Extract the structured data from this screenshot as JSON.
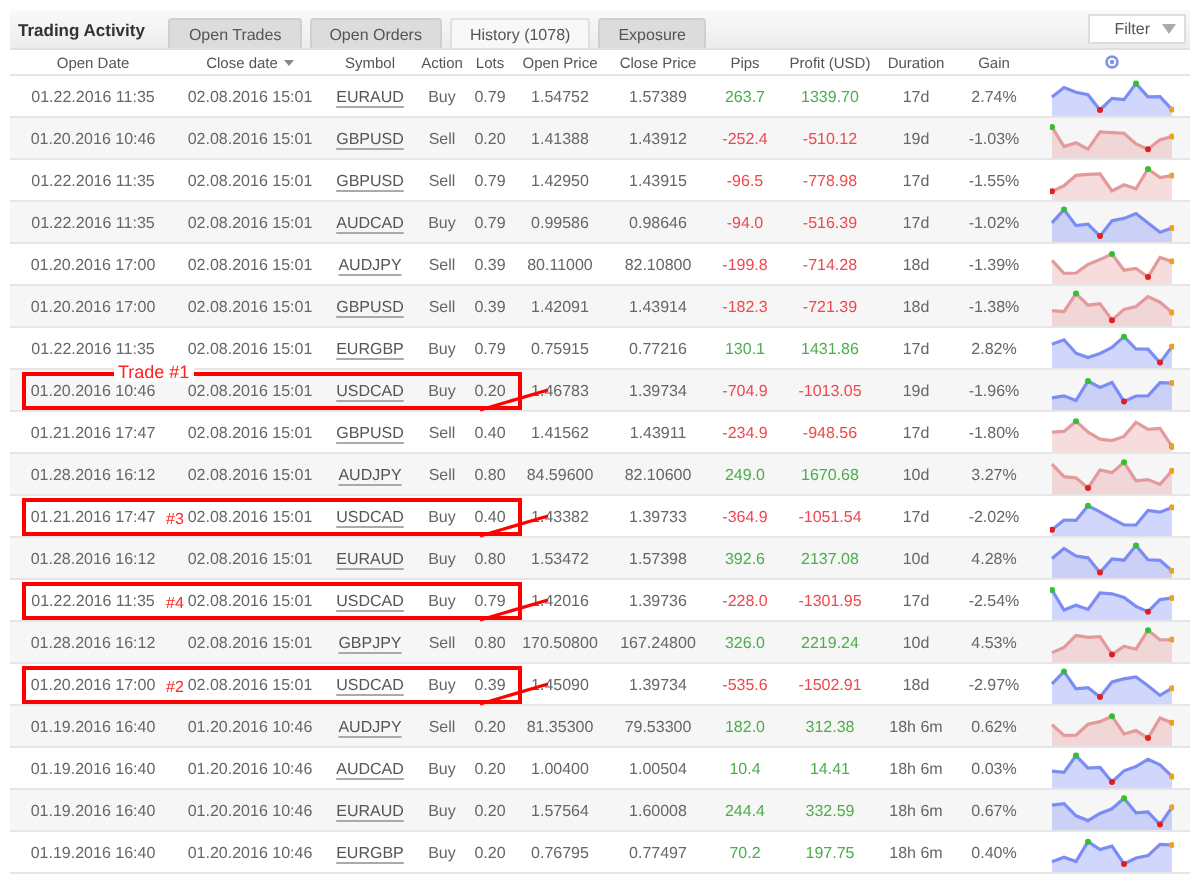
{
  "title": "Trading Activity",
  "tabs": [
    {
      "label": "Open Trades",
      "selected": false
    },
    {
      "label": "Open Orders",
      "selected": false
    },
    {
      "label": "History (1078)",
      "selected": true
    },
    {
      "label": "Exposure",
      "selected": false
    }
  ],
  "filter_button": "Filter",
  "columns": [
    "Open Date",
    "Close date",
    "Symbol",
    "Action",
    "Lots",
    "Open Price",
    "Close Price",
    "Pips",
    "Profit (USD)",
    "Duration",
    "Gain"
  ],
  "rows": [
    {
      "open_date": "01.22.2016 11:35",
      "close_date": "02.08.2016 15:01",
      "symbol": "EURAUD",
      "action": "Buy",
      "lots": "0.79",
      "open_price": "1.54752",
      "close_price": "1.57389",
      "pips": "263.7",
      "profit": "1339.70",
      "duration": "17d",
      "gain": "2.74%",
      "loss": false,
      "color": "#7b8cf5"
    },
    {
      "open_date": "01.20.2016 10:46",
      "close_date": "02.08.2016 15:01",
      "symbol": "GBPUSD",
      "action": "Sell",
      "lots": "0.20",
      "open_price": "1.41388",
      "close_price": "1.43912",
      "pips": "-252.4",
      "profit": "-510.12",
      "duration": "19d",
      "gain": "-1.03%",
      "loss": true,
      "color": "#e49a9a"
    },
    {
      "open_date": "01.22.2016 11:35",
      "close_date": "02.08.2016 15:01",
      "symbol": "GBPUSD",
      "action": "Sell",
      "lots": "0.79",
      "open_price": "1.42950",
      "close_price": "1.43915",
      "pips": "-96.5",
      "profit": "-778.98",
      "duration": "17d",
      "gain": "-1.55%",
      "loss": true,
      "color": "#e49a9a"
    },
    {
      "open_date": "01.22.2016 11:35",
      "close_date": "02.08.2016 15:01",
      "symbol": "AUDCAD",
      "action": "Buy",
      "lots": "0.79",
      "open_price": "0.99586",
      "close_price": "0.98646",
      "pips": "-94.0",
      "profit": "-516.39",
      "duration": "17d",
      "gain": "-1.02%",
      "loss": true,
      "color": "#7b8cf5"
    },
    {
      "open_date": "01.20.2016 17:00",
      "close_date": "02.08.2016 15:01",
      "symbol": "AUDJPY",
      "action": "Sell",
      "lots": "0.39",
      "open_price": "80.11000",
      "close_price": "82.10800",
      "pips": "-199.8",
      "profit": "-714.28",
      "duration": "18d",
      "gain": "-1.39%",
      "loss": true,
      "color": "#e49a9a"
    },
    {
      "open_date": "01.20.2016 17:00",
      "close_date": "02.08.2016 15:01",
      "symbol": "GBPUSD",
      "action": "Sell",
      "lots": "0.39",
      "open_price": "1.42091",
      "close_price": "1.43914",
      "pips": "-182.3",
      "profit": "-721.39",
      "duration": "18d",
      "gain": "-1.38%",
      "loss": true,
      "color": "#e49a9a"
    },
    {
      "open_date": "01.22.2016 11:35",
      "close_date": "02.08.2016 15:01",
      "symbol": "EURGBP",
      "action": "Buy",
      "lots": "0.79",
      "open_price": "0.75915",
      "close_price": "0.77216",
      "pips": "130.1",
      "profit": "1431.86",
      "duration": "17d",
      "gain": "2.82%",
      "loss": false,
      "color": "#7b8cf5"
    },
    {
      "open_date": "01.20.2016 10:46",
      "close_date": "02.08.2016 15:01",
      "symbol": "USDCAD",
      "action": "Buy",
      "lots": "0.20",
      "open_price": "1.46783",
      "close_price": "1.39734",
      "pips": "-704.9",
      "profit": "-1013.05",
      "duration": "19d",
      "gain": "-1.96%",
      "loss": true,
      "color": "#7b8cf5",
      "annotation": {
        "label": "Trade #1",
        "label_above": true
      }
    },
    {
      "open_date": "01.21.2016 17:47",
      "close_date": "02.08.2016 15:01",
      "symbol": "GBPUSD",
      "action": "Sell",
      "lots": "0.40",
      "open_price": "1.41562",
      "close_price": "1.43911",
      "pips": "-234.9",
      "profit": "-948.56",
      "duration": "17d",
      "gain": "-1.80%",
      "loss": true,
      "color": "#e49a9a"
    },
    {
      "open_date": "01.28.2016 16:12",
      "close_date": "02.08.2016 15:01",
      "symbol": "AUDJPY",
      "action": "Sell",
      "lots": "0.80",
      "open_price": "84.59600",
      "close_price": "82.10600",
      "pips": "249.0",
      "profit": "1670.68",
      "duration": "10d",
      "gain": "3.27%",
      "loss": false,
      "color": "#e49a9a"
    },
    {
      "open_date": "01.21.2016 17:47",
      "close_date": "02.08.2016 15:01",
      "symbol": "USDCAD",
      "action": "Buy",
      "lots": "0.40",
      "open_price": "1.43382",
      "close_price": "1.39733",
      "pips": "-364.9",
      "profit": "-1051.54",
      "duration": "17d",
      "gain": "-2.02%",
      "loss": true,
      "color": "#7b8cf5",
      "annotation": {
        "label": "#3",
        "label_above": false
      }
    },
    {
      "open_date": "01.28.2016 16:12",
      "close_date": "02.08.2016 15:01",
      "symbol": "EURAUD",
      "action": "Buy",
      "lots": "0.80",
      "open_price": "1.53472",
      "close_price": "1.57398",
      "pips": "392.6",
      "profit": "2137.08",
      "duration": "10d",
      "gain": "4.28%",
      "loss": false,
      "color": "#7b8cf5"
    },
    {
      "open_date": "01.22.2016 11:35",
      "close_date": "02.08.2016 15:01",
      "symbol": "USDCAD",
      "action": "Buy",
      "lots": "0.79",
      "open_price": "1.42016",
      "close_price": "1.39736",
      "pips": "-228.0",
      "profit": "-1301.95",
      "duration": "17d",
      "gain": "-2.54%",
      "loss": true,
      "color": "#7b8cf5",
      "annotation": {
        "label": "#4",
        "label_above": false
      }
    },
    {
      "open_date": "01.28.2016 16:12",
      "close_date": "02.08.2016 15:01",
      "symbol": "GBPJPY",
      "action": "Sell",
      "lots": "0.80",
      "open_price": "170.50800",
      "close_price": "167.24800",
      "pips": "326.0",
      "profit": "2219.24",
      "duration": "10d",
      "gain": "4.53%",
      "loss": false,
      "color": "#e49a9a"
    },
    {
      "open_date": "01.20.2016 17:00",
      "close_date": "02.08.2016 15:01",
      "symbol": "USDCAD",
      "action": "Buy",
      "lots": "0.39",
      "open_price": "1.45090",
      "close_price": "1.39734",
      "pips": "-535.6",
      "profit": "-1502.91",
      "duration": "18d",
      "gain": "-2.97%",
      "loss": true,
      "color": "#7b8cf5",
      "annotation": {
        "label": "#2",
        "label_above": false
      }
    },
    {
      "open_date": "01.19.2016 16:40",
      "close_date": "01.20.2016 10:46",
      "symbol": "AUDJPY",
      "action": "Sell",
      "lots": "0.20",
      "open_price": "81.35300",
      "close_price": "79.53300",
      "pips": "182.0",
      "profit": "312.38",
      "duration": "18h 6m",
      "gain": "0.62%",
      "loss": false,
      "color": "#e49a9a"
    },
    {
      "open_date": "01.19.2016 16:40",
      "close_date": "01.20.2016 10:46",
      "symbol": "AUDCAD",
      "action": "Buy",
      "lots": "0.20",
      "open_price": "1.00400",
      "close_price": "1.00504",
      "pips": "10.4",
      "profit": "14.41",
      "duration": "18h 6m",
      "gain": "0.03%",
      "loss": false,
      "color": "#7b8cf5"
    },
    {
      "open_date": "01.19.2016 16:40",
      "close_date": "01.20.2016 10:46",
      "symbol": "EURAUD",
      "action": "Buy",
      "lots": "0.20",
      "open_price": "1.57564",
      "close_price": "1.60008",
      "pips": "244.4",
      "profit": "332.59",
      "duration": "18h 6m",
      "gain": "0.67%",
      "loss": false,
      "color": "#7b8cf5"
    },
    {
      "open_date": "01.19.2016 16:40",
      "close_date": "01.20.2016 10:46",
      "symbol": "EURGBP",
      "action": "Buy",
      "lots": "0.20",
      "open_price": "0.76795",
      "close_price": "0.77497",
      "pips": "70.2",
      "profit": "197.75",
      "duration": "18h 6m",
      "gain": "0.40%",
      "loss": false,
      "color": "#7b8cf5"
    }
  ]
}
